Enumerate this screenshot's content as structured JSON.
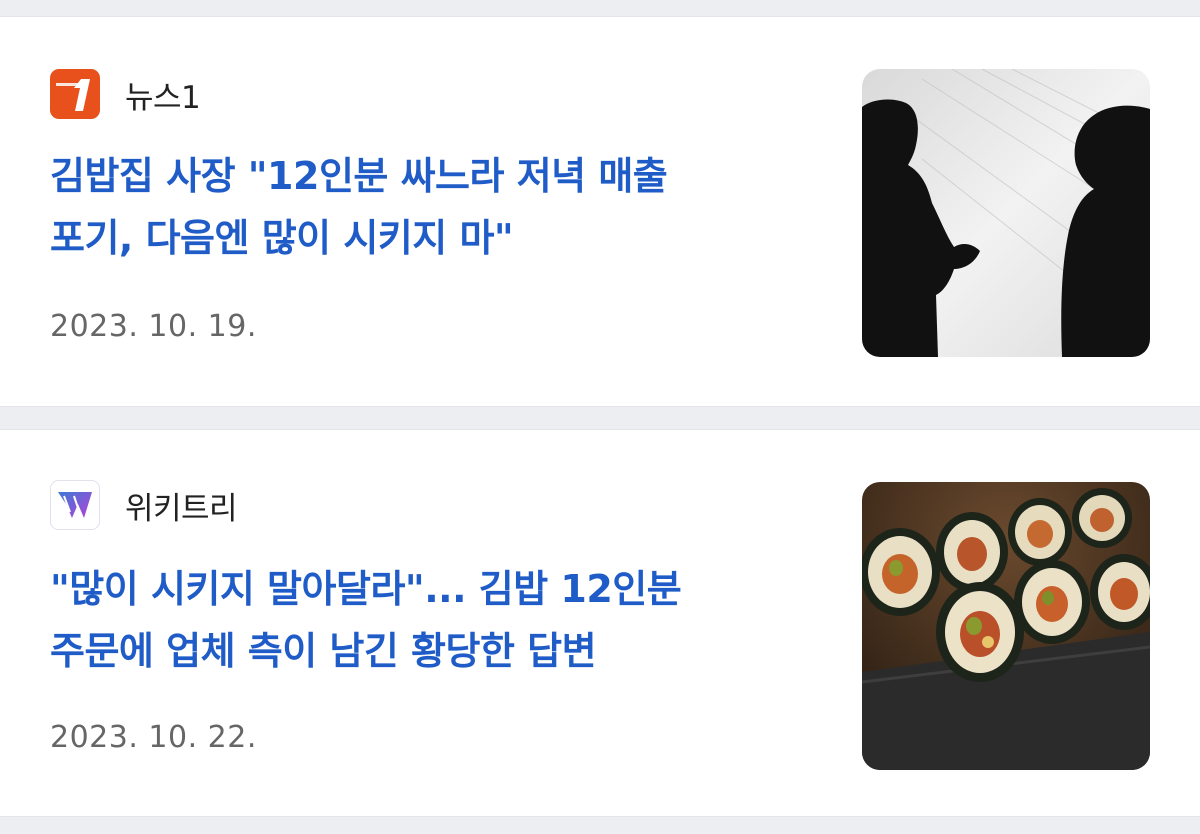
{
  "articles": [
    {
      "source": "뉴스1",
      "source_icon": "news1-logo",
      "headline_line1": "김밥집 사장 \"12인분 싸느라 저녁 매출",
      "headline_line2": "포기, 다음엔 많이 시키지 마\"",
      "date": "2023. 10. 19.",
      "thumbnail": "two-silhouettes-talking",
      "accent": "#e8501c"
    },
    {
      "source": "위키트리",
      "source_icon": "wikitree-logo",
      "headline_line1": "\"많이 시키지 말아달라\"... 김밥 12인분",
      "headline_line2": "주문에 업체 측이 남긴 황당한 답변",
      "date": "2023. 10. 22.",
      "thumbnail": "gimbap-rolls-on-plate",
      "accent": "#6a3fd6"
    }
  ],
  "colors": {
    "headline": "#1f5cc7",
    "date": "#666666",
    "background": "#eceef2"
  }
}
